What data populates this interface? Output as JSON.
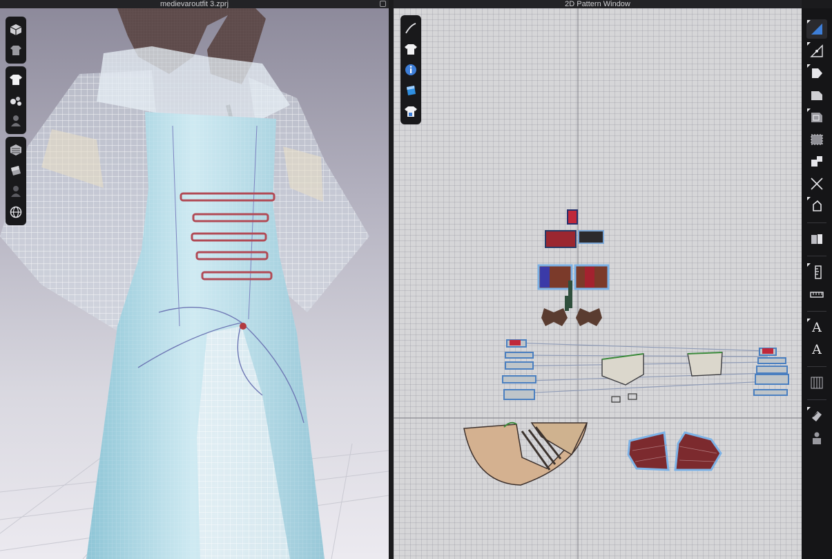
{
  "windows": {
    "left_title": "medievaroutfit 3.zprj",
    "right_title": "2D Pattern Window"
  },
  "viewport3d": {
    "palettes": [
      [
        {
          "icon": "avatar-cube-icon"
        },
        {
          "icon": "garment-display-icon"
        }
      ],
      [
        {
          "icon": "shirt-icon"
        },
        {
          "icon": "fabric-points-icon"
        },
        {
          "icon": "avatar-silhouette-icon"
        }
      ],
      [
        {
          "icon": "texture-cube-icon"
        },
        {
          "icon": "shaded-surface-icon"
        },
        {
          "icon": "avatar-dark-icon"
        },
        {
          "icon": "globe-icon"
        }
      ]
    ]
  },
  "viewport2d": {
    "palette": [
      {
        "icon": "needle-icon"
      },
      {
        "icon": "shirt-icon"
      },
      {
        "icon": "info-icon"
      },
      {
        "icon": "fabric-swatch-icon"
      },
      {
        "icon": "shirt-lock-icon"
      }
    ]
  },
  "right_toolbar": [
    {
      "icon": "select-pattern-icon",
      "active": true
    },
    {
      "icon": "edit-point-line-icon"
    },
    {
      "icon": "transform-pattern-icon"
    },
    {
      "icon": "polygon-icon"
    },
    {
      "icon": "internal-polygon-icon"
    },
    {
      "icon": "trace-icon"
    },
    {
      "icon": "segment-sewing-icon"
    },
    {
      "icon": "free-sewing-icon"
    },
    {
      "icon": "tack-icon"
    },
    {
      "icon": "fold-arrangement-icon"
    },
    {
      "icon": "ruler-icon"
    },
    {
      "icon": "measure-icon"
    },
    {
      "icon": "annotation-text-icon",
      "label": "A"
    },
    {
      "icon": "text-icon",
      "label": "A"
    },
    {
      "icon": "grading-icon"
    },
    {
      "icon": "puckering-icon"
    },
    {
      "icon": "avatar-fit-icon"
    }
  ]
}
